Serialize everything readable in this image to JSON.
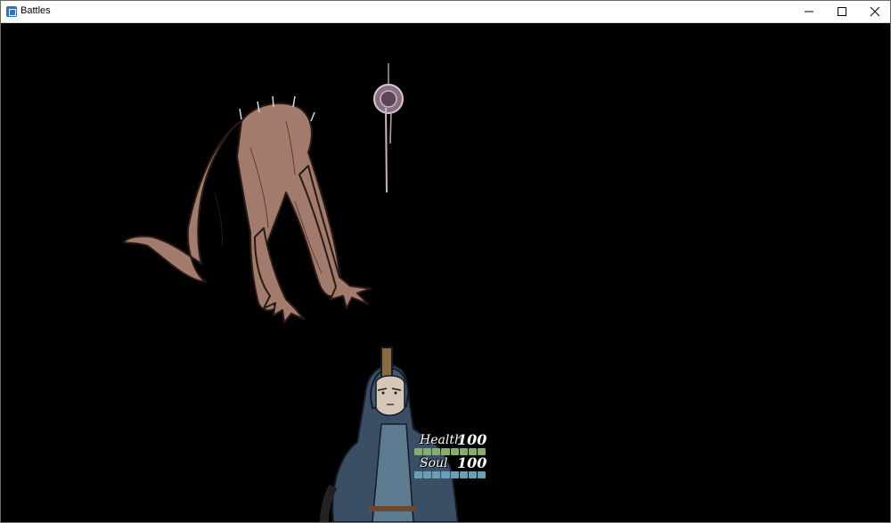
{
  "window": {
    "title": "Battles"
  },
  "hud": {
    "health": {
      "label": "Health",
      "value": "100",
      "fraction": 1.0,
      "color": "#86ad6d"
    },
    "soul": {
      "label": "Soul",
      "value": "100",
      "fraction": 1.0,
      "color": "#6a9fb8"
    }
  },
  "sprites": {
    "enemy": "crawling-creature",
    "orb": "floating-eye-orb",
    "player": "hooded-knight-portrait"
  }
}
